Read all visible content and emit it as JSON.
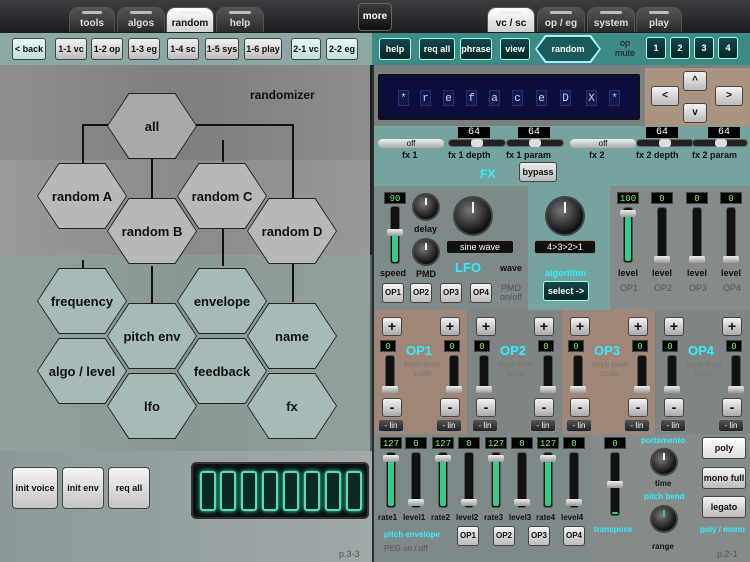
{
  "top_tabs_left": [
    "tools",
    "algos",
    "random",
    "help"
  ],
  "more_label": "more",
  "top_tabs_right": [
    "vc / sc",
    "op / eg",
    "system",
    "play"
  ],
  "nav_left": [
    "< back",
    "1-1 vc",
    "1-2 op",
    "1-3 eg",
    "1-4 sc",
    "1-5 sys",
    "1-6 play",
    "2-1 vc",
    "2-2 eg"
  ],
  "nav_right": [
    "help",
    "req all",
    "phrase",
    "view",
    "random"
  ],
  "op_mute": {
    "label": "op mute",
    "buttons": [
      "1",
      "2",
      "3",
      "4"
    ]
  },
  "randomizer": {
    "title": "randomizer",
    "hexes": [
      "all",
      "random A",
      "random B",
      "random C",
      "random D",
      "frequency",
      "envelope",
      "pitch env",
      "name",
      "algo / level",
      "feedback",
      "lfo",
      "fx"
    ]
  },
  "left_bottom": {
    "buttons": [
      "init voice",
      "init env",
      "req all"
    ],
    "page": "p.3-3"
  },
  "display_chars": [
    "*",
    "r",
    "e",
    "f",
    "a",
    "c",
    "e",
    "D",
    "X",
    "*"
  ],
  "arrows": {
    "up": "^",
    "left": "<",
    "right": ">",
    "down": "v"
  },
  "fx": {
    "fx1_switch": "off",
    "fx1_label": "fx 1",
    "fx1_depth_value": "64",
    "fx1_depth_label": "fx 1 depth",
    "fx1_param_value": "64",
    "fx1_param_label": "fx 1 param",
    "fx2_switch": "off",
    "fx2_label": "fx 2",
    "fx2_depth_value": "64",
    "fx2_depth_label": "fx 2 depth",
    "fx2_param_value": "64",
    "fx2_param_label": "fx 2 param",
    "section_label": "FX",
    "bypass": "bypass"
  },
  "lfo": {
    "speed_value": "90",
    "speed_label": "speed",
    "delay_value": "0",
    "delay_label": "delay",
    "pmd_value": "0",
    "pmd_label": "PMD",
    "wave_display": "sine wave",
    "wave_label": "wave",
    "title": "LFO",
    "pmd_onoff": "PMD on/off",
    "op_buttons": [
      "OP1",
      "OP2",
      "OP3",
      "OP4"
    ]
  },
  "algorithm": {
    "display": "4>3>2>1",
    "label": "algorithm",
    "select": "select ->"
  },
  "levels": {
    "values": [
      "100",
      "0",
      "0",
      "0"
    ],
    "labels": [
      "level",
      "level",
      "level",
      "level"
    ],
    "ops": [
      "OP1",
      "OP2",
      "OP3",
      "OP4"
    ]
  },
  "op_sections": [
    {
      "name": "OP1",
      "value": "0",
      "kls": "keyb level scale",
      "plus": "+",
      "minus": "-",
      "lin1": "- lin",
      "lin2": "- lin"
    },
    {
      "name": "OP2",
      "value": "0",
      "kls": "keyb level scale",
      "plus": "+",
      "minus": "-",
      "lin1": "- lin",
      "lin2": "- lin"
    },
    {
      "name": "OP3",
      "value": "0",
      "kls": "keyb level scale",
      "plus": "+",
      "minus": "-",
      "lin1": "- lin",
      "lin2": "- lin"
    },
    {
      "name": "OP4",
      "value": "0",
      "kls": "keyb level scale",
      "plus": "+",
      "minus": "-",
      "lin1": "- lin",
      "lin2": "- lin"
    }
  ],
  "pitch_envelope": {
    "values": [
      "127",
      "0",
      "127",
      "0",
      "127",
      "0",
      "127",
      "0"
    ],
    "labels": [
      "rate1",
      "level1",
      "rate2",
      "level2",
      "rate3",
      "level3",
      "rate4",
      "level4"
    ],
    "title": "pitch envelope",
    "onoff": "PEG on / off",
    "op_buttons": [
      "OP1",
      "OP2",
      "OP3",
      "OP4"
    ]
  },
  "portamento": {
    "transpose_value": "0",
    "transpose_label": "transpose",
    "portamento_label": "portamento",
    "time_label": "time",
    "pitch_bend_label": "pitch bend",
    "range_label": "range",
    "poly": "poly",
    "mono_full": "mono full",
    "legato": "legato",
    "poly_mono": "poly / mono",
    "page": "p.2-1"
  }
}
